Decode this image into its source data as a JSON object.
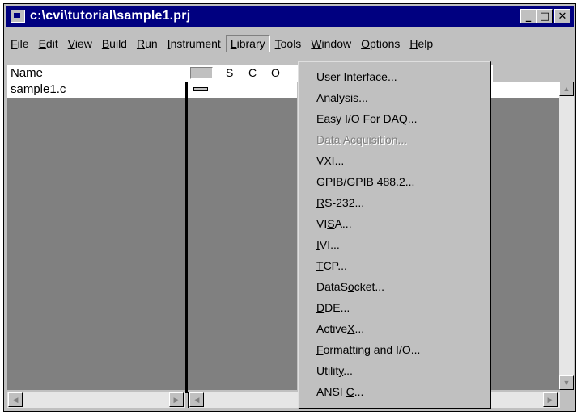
{
  "window": {
    "title": "c:\\cvi\\tutorial\\sample1.prj",
    "minimize": "_",
    "maximize": "□",
    "close": "✕"
  },
  "menubar": [
    {
      "pre": "",
      "key": "F",
      "post": "ile"
    },
    {
      "pre": "",
      "key": "E",
      "post": "dit"
    },
    {
      "pre": "",
      "key": "V",
      "post": "iew"
    },
    {
      "pre": "",
      "key": "B",
      "post": "uild"
    },
    {
      "pre": "",
      "key": "R",
      "post": "un"
    },
    {
      "pre": "",
      "key": "I",
      "post": "nstrument"
    },
    {
      "pre": "",
      "key": "L",
      "post": "ibrary"
    },
    {
      "pre": "",
      "key": "T",
      "post": "ools"
    },
    {
      "pre": "",
      "key": "W",
      "post": "indow"
    },
    {
      "pre": "",
      "key": "O",
      "post": "ptions"
    },
    {
      "pre": "",
      "key": "H",
      "post": "elp"
    }
  ],
  "columns": {
    "name": "Name",
    "s": "S",
    "c": "C",
    "o": "O"
  },
  "files": [
    "sample1.c"
  ],
  "library_menu": [
    {
      "pre": "",
      "key": "U",
      "post": "ser Interface...",
      "enabled": true
    },
    {
      "pre": "",
      "key": "A",
      "post": "nalysis...",
      "enabled": true
    },
    {
      "pre": "",
      "key": "E",
      "post": "asy I/O For DAQ...",
      "enabled": true
    },
    {
      "pre": "Data Acquisition...",
      "key": "",
      "post": "",
      "enabled": false
    },
    {
      "pre": "",
      "key": "V",
      "post": "XI...",
      "enabled": true
    },
    {
      "pre": "",
      "key": "G",
      "post": "PIB/GPIB 488.2...",
      "enabled": true
    },
    {
      "pre": "",
      "key": "R",
      "post": "S-232...",
      "enabled": true
    },
    {
      "pre": "VI",
      "key": "S",
      "post": "A...",
      "enabled": true
    },
    {
      "pre": "",
      "key": "I",
      "post": "VI...",
      "enabled": true
    },
    {
      "pre": "",
      "key": "T",
      "post": "CP...",
      "enabled": true
    },
    {
      "pre": "DataS",
      "key": "o",
      "post": "cket...",
      "enabled": true
    },
    {
      "pre": "",
      "key": "D",
      "post": "DE...",
      "enabled": true
    },
    {
      "pre": "Active",
      "key": "X",
      "post": "...",
      "enabled": true
    },
    {
      "pre": "",
      "key": "F",
      "post": "ormatting and I/O...",
      "enabled": true
    },
    {
      "pre": "Utilit",
      "key": "y",
      "post": "...",
      "enabled": true
    },
    {
      "pre": "ANSI ",
      "key": "C",
      "post": "...",
      "enabled": true
    }
  ],
  "icons": {
    "app": "project-icon",
    "scroll_up": "arrow-up-icon",
    "scroll_down": "arrow-down-icon",
    "scroll_left": "arrow-left-icon",
    "scroll_right": "arrow-right-icon"
  }
}
